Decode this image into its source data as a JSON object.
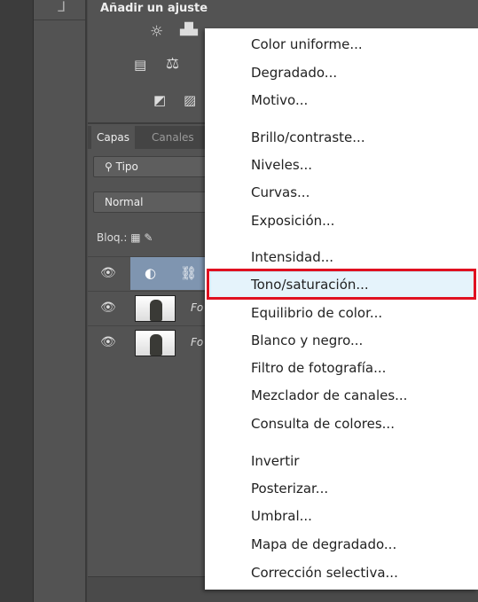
{
  "adjustments": {
    "title": "Añadir un ajuste"
  },
  "layers": {
    "tabs": [
      "Capas",
      "Canales"
    ],
    "filter": "Tipo",
    "blend_mode": "Normal",
    "lock_label": "Bloq.:",
    "rows": [
      {
        "name": "",
        "selected": true
      },
      {
        "name": "Fo"
      },
      {
        "name": "Fo"
      }
    ]
  },
  "menu": {
    "items": [
      "Color uniforme...",
      "Degradado...",
      "Motivo...",
      "Brillo/contraste...",
      "Niveles...",
      "Curvas...",
      "Exposición...",
      "Intensidad...",
      "Tono/saturación...",
      "Equilibrio de color...",
      "Blanco y negro...",
      "Filtro de fotografía...",
      "Mezclador de canales...",
      "Consulta de colores...",
      "Invertir",
      "Posterizar...",
      "Umbral...",
      "Mapa de degradado...",
      "Corrección selectiva..."
    ],
    "highlighted": "Tono/saturación..."
  },
  "colors": {
    "highlight_box": "#e01020",
    "selection": "#7f95b0"
  }
}
